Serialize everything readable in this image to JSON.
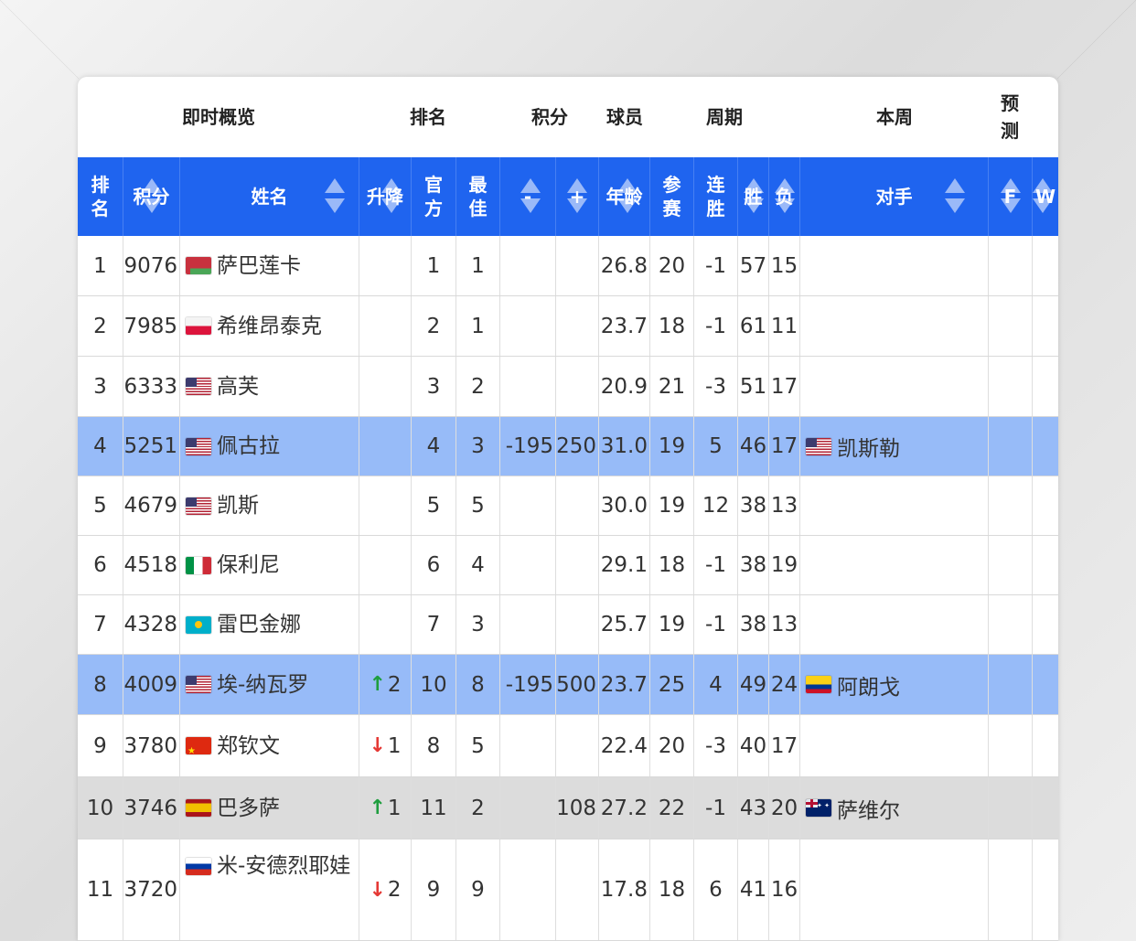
{
  "group_headers": {
    "overview": "即时概览",
    "rank": "排名",
    "points": "积分",
    "player": "球员",
    "period": "周期",
    "this_week": "本周",
    "forecast": "预\n测"
  },
  "columns": {
    "rank": "排\n名",
    "points": "积分",
    "name": "姓名",
    "change": "升降",
    "official": "官\n方",
    "best": "最\n佳",
    "minus": "-",
    "plus": "+",
    "age": "年龄",
    "played": "参\n赛",
    "streak": "连\n胜",
    "win": "胜",
    "loss": "负",
    "opponent": "对手",
    "f": "F",
    "w": "W"
  },
  "rows": [
    {
      "rank": "1",
      "points": "9076",
      "flag": "by",
      "name": "萨巴莲卡",
      "change_dir": "",
      "change": "",
      "official": "1",
      "best": "1",
      "minus": "",
      "plus": "",
      "age": "26.8",
      "played": "20",
      "streak": "-1",
      "win": "57",
      "loss": "15",
      "opp_flag": "",
      "opponent": "",
      "style": ""
    },
    {
      "rank": "2",
      "points": "7985",
      "flag": "pl",
      "name": "希维昂泰克",
      "change_dir": "",
      "change": "",
      "official": "2",
      "best": "1",
      "minus": "",
      "plus": "",
      "age": "23.7",
      "played": "18",
      "streak": "-1",
      "win": "61",
      "loss": "11",
      "opp_flag": "",
      "opponent": "",
      "style": ""
    },
    {
      "rank": "3",
      "points": "6333",
      "flag": "us",
      "name": "高芙",
      "change_dir": "",
      "change": "",
      "official": "3",
      "best": "2",
      "minus": "",
      "plus": "",
      "age": "20.9",
      "played": "21",
      "streak": "-3",
      "win": "51",
      "loss": "17",
      "opp_flag": "",
      "opponent": "",
      "style": ""
    },
    {
      "rank": "4",
      "points": "5251",
      "flag": "us",
      "name": "佩古拉",
      "change_dir": "",
      "change": "",
      "official": "4",
      "best": "3",
      "minus": "-195",
      "plus": "250",
      "age": "31.0",
      "played": "19",
      "streak": "5",
      "win": "46",
      "loss": "17",
      "opp_flag": "us",
      "opponent": "凯斯勒",
      "style": "hl"
    },
    {
      "rank": "5",
      "points": "4679",
      "flag": "us",
      "name": "凯斯",
      "change_dir": "",
      "change": "",
      "official": "5",
      "best": "5",
      "minus": "",
      "plus": "",
      "age": "30.0",
      "played": "19",
      "streak": "12",
      "win": "38",
      "loss": "13",
      "opp_flag": "",
      "opponent": "",
      "style": ""
    },
    {
      "rank": "6",
      "points": "4518",
      "flag": "it",
      "name": "保利尼",
      "change_dir": "",
      "change": "",
      "official": "6",
      "best": "4",
      "minus": "",
      "plus": "",
      "age": "29.1",
      "played": "18",
      "streak": "-1",
      "win": "38",
      "loss": "19",
      "opp_flag": "",
      "opponent": "",
      "style": ""
    },
    {
      "rank": "7",
      "points": "4328",
      "flag": "kz",
      "name": "雷巴金娜",
      "change_dir": "",
      "change": "",
      "official": "7",
      "best": "3",
      "minus": "",
      "plus": "",
      "age": "25.7",
      "played": "19",
      "streak": "-1",
      "win": "38",
      "loss": "13",
      "opp_flag": "",
      "opponent": "",
      "style": ""
    },
    {
      "rank": "8",
      "points": "4009",
      "flag": "us",
      "name": "埃-纳瓦罗",
      "change_dir": "up",
      "change": "2",
      "official": "10",
      "best": "8",
      "minus": "-195",
      "plus": "500",
      "age": "23.7",
      "played": "25",
      "streak": "4",
      "win": "49",
      "loss": "24",
      "opp_flag": "co",
      "opponent": "阿朗戈",
      "style": "hl"
    },
    {
      "rank": "9",
      "points": "3780",
      "flag": "cn",
      "name": "郑钦文",
      "change_dir": "down",
      "change": "1",
      "official": "8",
      "best": "5",
      "minus": "",
      "plus": "",
      "age": "22.4",
      "played": "20",
      "streak": "-3",
      "win": "40",
      "loss": "17",
      "opp_flag": "",
      "opponent": "",
      "style": ""
    },
    {
      "rank": "10",
      "points": "3746",
      "flag": "es",
      "name": "巴多萨",
      "change_dir": "up",
      "change": "1",
      "official": "11",
      "best": "2",
      "minus": "",
      "plus": "108",
      "age": "27.2",
      "played": "22",
      "streak": "-1",
      "win": "43",
      "loss": "20",
      "opp_flag": "au",
      "opponent": "萨维尔",
      "style": "gray"
    },
    {
      "rank": "11",
      "points": "3720",
      "flag": "ru",
      "name": "米-安德烈耶娃",
      "change_dir": "down",
      "change": "2",
      "official": "9",
      "best": "9",
      "minus": "",
      "plus": "",
      "age": "17.8",
      "played": "18",
      "streak": "6",
      "win": "41",
      "loss": "16",
      "opp_flag": "",
      "opponent": "",
      "style": ""
    }
  ],
  "icons": {
    "up": "up-arrow-icon",
    "down": "down-arrow-icon",
    "sort": "sort-icon"
  },
  "colors": {
    "header_blue": "#1f64ef",
    "highlight_row": "#97bbf8",
    "gray_row": "#dcdcdc",
    "up": "#1e9e3e",
    "down": "#e53935"
  }
}
